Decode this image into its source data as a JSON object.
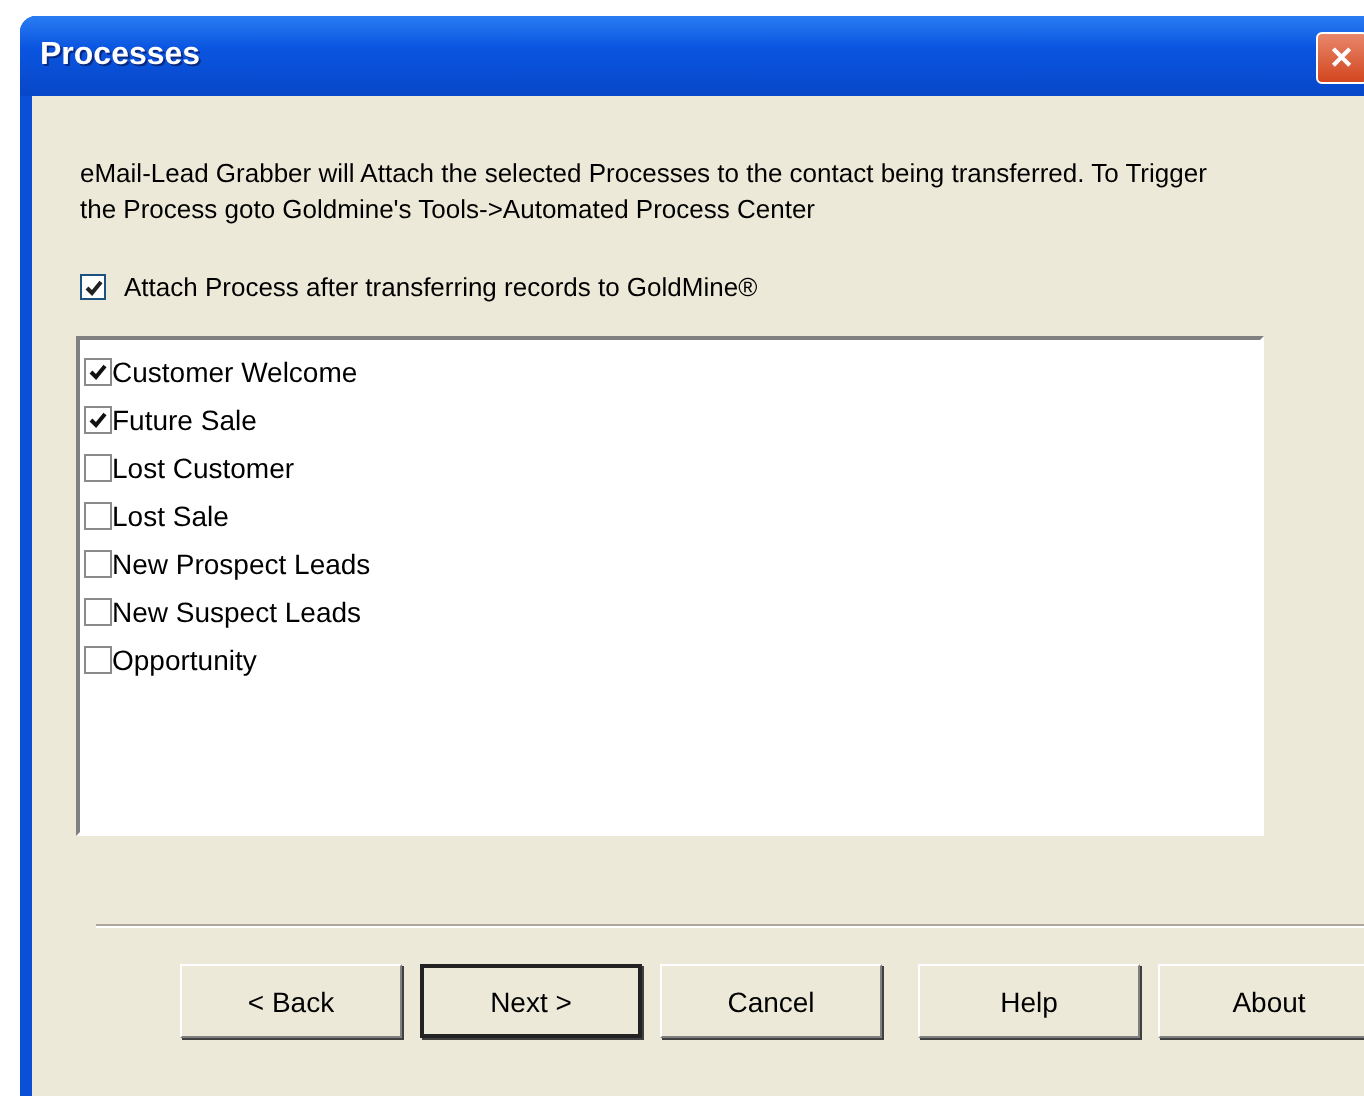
{
  "window": {
    "title": "Processes",
    "close": "✕"
  },
  "description": "eMail-Lead Grabber will Attach the selected Processes to the contact being transferred. To Trigger the Process goto Goldmine's Tools->Automated Process Center",
  "attach_option": {
    "label": "Attach Process after transferring records to GoldMine®",
    "checked": true
  },
  "processes": [
    {
      "label": "Customer Welcome",
      "checked": true
    },
    {
      "label": "Future Sale",
      "checked": true
    },
    {
      "label": "Lost Customer",
      "checked": false
    },
    {
      "label": "Lost Sale",
      "checked": false
    },
    {
      "label": "New Prospect Leads",
      "checked": false
    },
    {
      "label": "New Suspect Leads",
      "checked": false
    },
    {
      "label": "Opportunity",
      "checked": false
    }
  ],
  "buttons": [
    {
      "label": "< Back",
      "default": false
    },
    {
      "label": "Next >",
      "default": true
    },
    {
      "label": "Cancel",
      "default": false
    },
    {
      "label": "Help",
      "default": false
    },
    {
      "label": "About",
      "default": false
    }
  ]
}
